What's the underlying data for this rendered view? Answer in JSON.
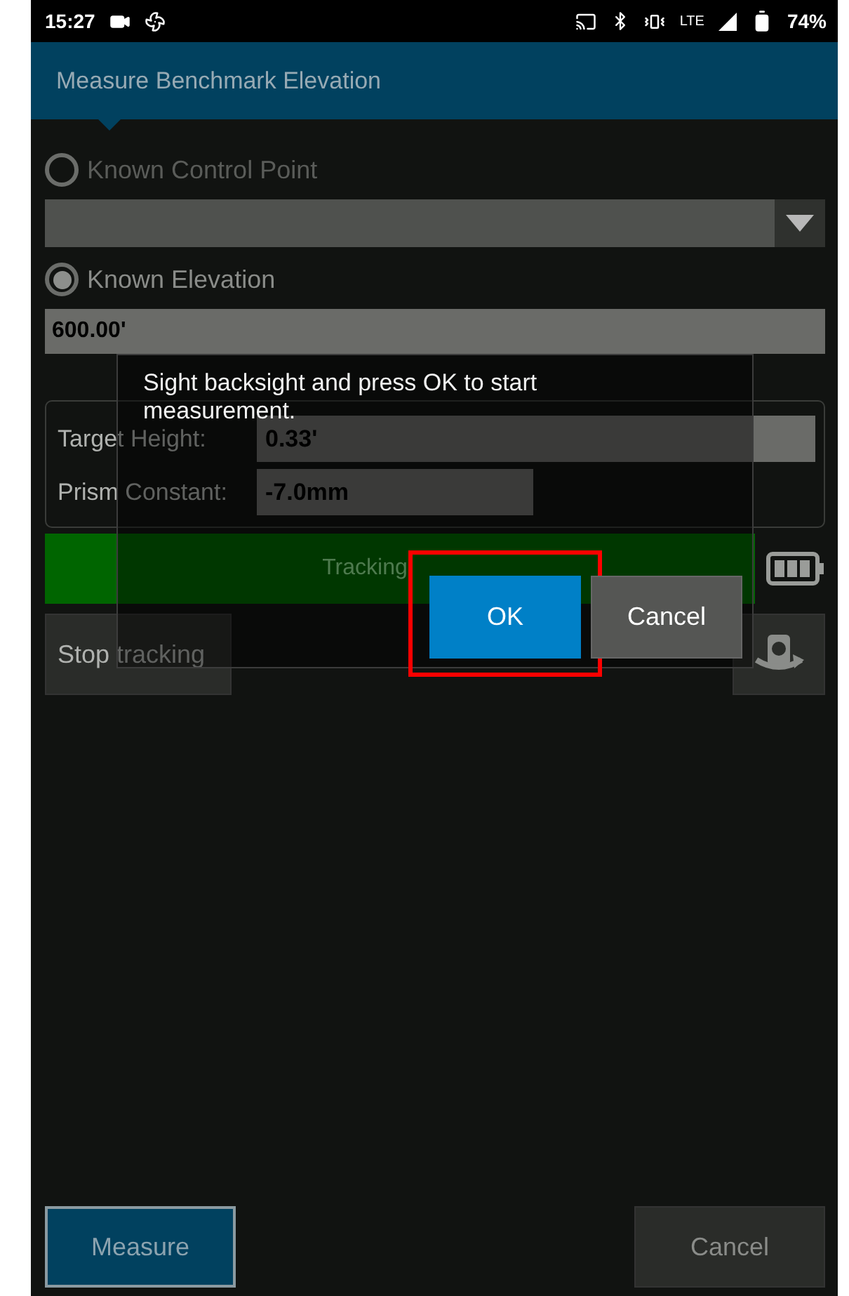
{
  "status_bar": {
    "time": "15:27",
    "network": "LTE",
    "battery": "74%"
  },
  "header": {
    "title": "Measure Benchmark Elevation"
  },
  "reference": [
    {
      "kind": "dropdown",
      "label": "Known Control Point",
      "selected": false
    },
    {
      "kind": "field",
      "label": "Known Elevation",
      "selected": true,
      "value": "600.00'"
    }
  ],
  "target_fields": [
    {
      "label": "Target Height:",
      "value": "0.33'",
      "kind": "wide"
    },
    {
      "label": "Prism Constant:",
      "value": "-7.0mm",
      "kind": "narrow"
    }
  ],
  "tracking": {
    "label": "Tracking",
    "button": "Stop tracking"
  },
  "dialog": {
    "message": "Sight backsight and press OK to start measurement.",
    "buttons": [
      {
        "label": "OK",
        "kind": "primary",
        "highlighted": true
      },
      {
        "label": "Cancel",
        "kind": "secondary",
        "highlighted": false
      }
    ]
  },
  "footer": {
    "buttons": [
      {
        "label": "Measure",
        "kind": "primary"
      },
      {
        "label": "Cancel",
        "kind": "secondary"
      }
    ]
  }
}
